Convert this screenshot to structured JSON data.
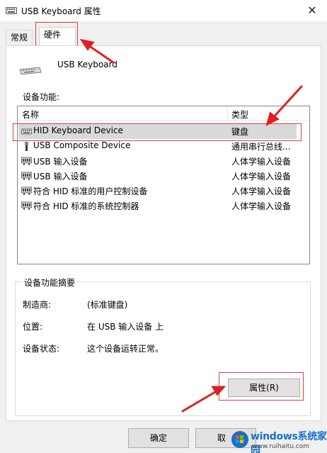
{
  "window": {
    "title": "USB Keyboard 属性",
    "close_glyph": "✕"
  },
  "tabs": [
    {
      "label": "常规",
      "active": false
    },
    {
      "label": "硬件",
      "active": true
    }
  ],
  "device": {
    "name": "USB Keyboard",
    "icon": "keyboard-icon"
  },
  "functions": {
    "label": "设备功能:",
    "columns": [
      "名称",
      "类型"
    ],
    "rows": [
      {
        "name": "HID Keyboard Device",
        "type": "键盘",
        "icon": "keyboard-icon",
        "selected": true
      },
      {
        "name": "USB Composite Device",
        "type": "通用串行总线...",
        "icon": "usb-plug-icon",
        "selected": false
      },
      {
        "name": "USB 输入设备",
        "type": "人体学输入设备",
        "icon": "hid-device-icon",
        "selected": false
      },
      {
        "name": "USB 输入设备",
        "type": "人体学输入设备",
        "icon": "hid-device-icon",
        "selected": false
      },
      {
        "name": "符合 HID 标准的用户控制设备",
        "type": "人体学输入设备",
        "icon": "hid-device-icon",
        "selected": false
      },
      {
        "name": "符合 HID 标准的系统控制器",
        "type": "人体学输入设备",
        "icon": "hid-device-icon",
        "selected": false
      }
    ]
  },
  "summary": {
    "legend": "设备功能摘要",
    "manufacturer_label": "制造商:",
    "manufacturer_value": "(标准键盘)",
    "location_label": "位置:",
    "location_value": "在 USB 输入设备 上",
    "status_label": "设备状态:",
    "status_value": "这个设备运转正常。",
    "properties_button": "属性(R)"
  },
  "footer": {
    "ok_label": "确定",
    "cancel_label": "取"
  },
  "watermark": {
    "brand": "windows系统家园",
    "site": "www.ruihaitu.com"
  },
  "annotation_color": "#e02020",
  "accent_color": "#1a6fc9"
}
